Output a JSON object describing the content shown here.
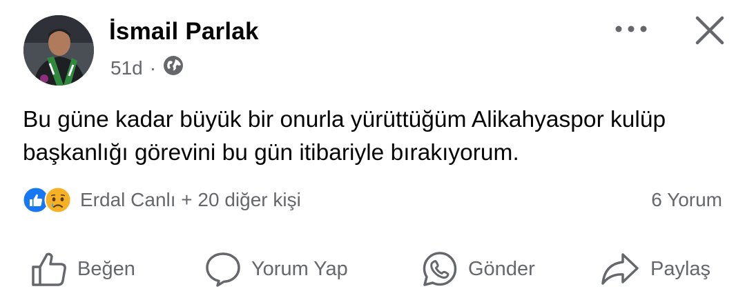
{
  "post": {
    "author": "İsmail Parlak",
    "time": "51d",
    "separator": "·",
    "privacy_icon": "globe-icon",
    "text": "Bu güne kadar büyük bir onurla yürüttüğüm Alikahyaspor kulüp başkanlığı görevini bu gün itibariyle bırakıyorum."
  },
  "header": {
    "more_icon": "more-icon",
    "close_icon": "close-icon"
  },
  "reactions": {
    "icons": [
      "like-icon",
      "sad-icon"
    ],
    "summary": "Erdal Canlı + 20 diğer kişi"
  },
  "comments": {
    "count_label": "6 Yorum"
  },
  "actions": {
    "like": "Beğen",
    "comment": "Yorum Yap",
    "send": "Gönder",
    "share": "Paylaş"
  },
  "colors": {
    "like_blue": "#1877f2",
    "sad_yellow": "#f7b125",
    "secondary_text": "#65676b",
    "primary_text": "#050505"
  }
}
